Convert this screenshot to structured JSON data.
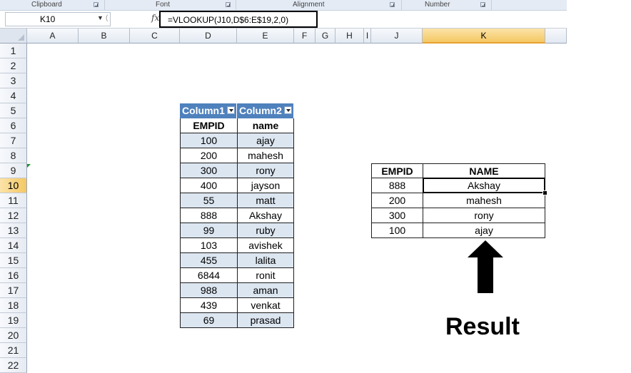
{
  "ribbon": {
    "groups": [
      "Clipboard",
      "Font",
      "Alignment",
      "Number"
    ]
  },
  "formula_bar": {
    "name_box": "K10",
    "formula": "=VLOOKUP(J10,D$6:E$19,2,0)"
  },
  "columns": [
    "A",
    "B",
    "C",
    "D",
    "E",
    "F",
    "G",
    "H",
    "I",
    "J",
    "K"
  ],
  "selected_column": "K",
  "rows": [
    "1",
    "2",
    "3",
    "4",
    "5",
    "6",
    "7",
    "8",
    "9",
    "10",
    "11",
    "12",
    "13",
    "14",
    "15",
    "16",
    "17",
    "18",
    "19",
    "20",
    "21",
    "22"
  ],
  "selected_row": "10",
  "source_table": {
    "headers": [
      "Column1",
      "Column2"
    ],
    "rows": [
      [
        "EMPID",
        "name"
      ],
      [
        "100",
        "ajay"
      ],
      [
        "200",
        "mahesh"
      ],
      [
        "300",
        "rony"
      ],
      [
        "400",
        "jayson"
      ],
      [
        "55",
        "matt"
      ],
      [
        "888",
        "Akshay"
      ],
      [
        "99",
        "ruby"
      ],
      [
        "103",
        "avishek"
      ],
      [
        "455",
        "lalita"
      ],
      [
        "6844",
        "ronit"
      ],
      [
        "988",
        "aman"
      ],
      [
        "439",
        "venkat"
      ],
      [
        "69",
        "prasad"
      ]
    ]
  },
  "lookup_table": {
    "rows": [
      [
        "EMPID",
        "NAME"
      ],
      [
        "888",
        "Akshay"
      ],
      [
        "200",
        "mahesh"
      ],
      [
        "300",
        "rony"
      ],
      [
        "100",
        "ajay"
      ]
    ]
  },
  "annotation": {
    "label": "Result",
    "arrow_icon": "up-arrow-icon"
  },
  "colors": {
    "table_header": "#4f81bd",
    "band_row": "#dce6f1",
    "selected_header": "#f4c864"
  }
}
